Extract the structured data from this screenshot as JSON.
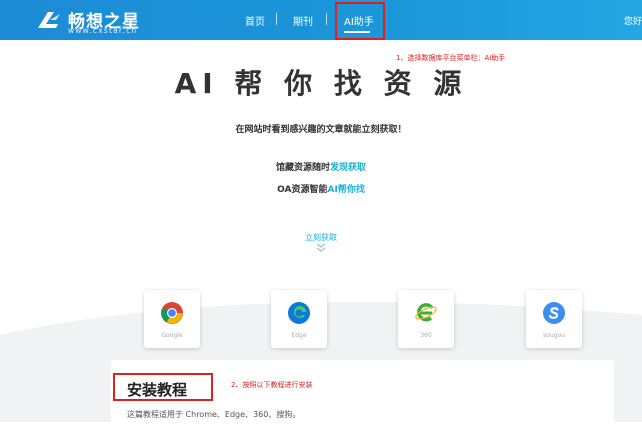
{
  "brand": {
    "name": "畅想之星",
    "url": "www.cxstar.cn"
  },
  "nav": {
    "items": [
      {
        "label": "首页"
      },
      {
        "label": "期刊"
      },
      {
        "label": "AI助手"
      }
    ],
    "user_link": "您好"
  },
  "annotations": {
    "step1": "1、选择数据库平台菜单栏：AI助手",
    "step2": "2、按照以下教程进行安装"
  },
  "hero": {
    "title": "AI 帮 你 找 资 源",
    "subtitle": "在网站时看到感兴趣的文章就能立刻获取！",
    "line1_prefix": "馆藏资源随时",
    "line1_accent": "发现获取",
    "line2_prefix": "OA资源智能",
    "line2_accent": "AI帮你找",
    "cta": "立刻获取"
  },
  "browsers": [
    {
      "label": "Google",
      "icon": "chrome-icon"
    },
    {
      "label": "Edge",
      "icon": "edge-icon"
    },
    {
      "label": "360",
      "icon": "360-browser-icon"
    },
    {
      "label": "sougou",
      "icon": "sogou-icon"
    }
  ],
  "install": {
    "title": "安装教程",
    "description": "这篇教程适用于 Chrome、Edge、360、搜狗。"
  },
  "colors": {
    "header": "#1d8bd6",
    "accent": "#1ab0d8",
    "annotation": "#e02020"
  }
}
